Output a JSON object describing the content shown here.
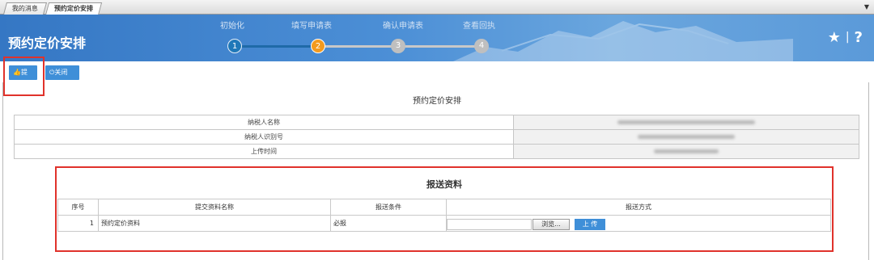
{
  "tabs": [
    {
      "label": "我的消息"
    },
    {
      "label": "预约定价安排"
    }
  ],
  "header": {
    "title": "预约定价安排",
    "steps": [
      {
        "label": "初始化",
        "number": "1",
        "state": "done",
        "color": "#1f78b8"
      },
      {
        "label": "填写申请表",
        "number": "2",
        "state": "current",
        "color": "#f39a1e"
      },
      {
        "label": "确认申请表",
        "number": "3",
        "state": "todo",
        "color": "#bfbfbf"
      },
      {
        "label": "查看回执",
        "number": "4",
        "state": "todo",
        "color": "#bfbfbf"
      }
    ],
    "icons": [
      "star-icon",
      "help-icon"
    ]
  },
  "toolbar": {
    "submit_label": "提交",
    "close_label": "关闭",
    "accent": "#3f8fd8"
  },
  "section_title": "预约定价安排",
  "info_rows": [
    {
      "label": "纳税人名称"
    },
    {
      "label": "纳税人识别号"
    },
    {
      "label": "上传时间"
    }
  ],
  "materials": {
    "title": "报送资料",
    "columns": [
      "序号",
      "提交资料名称",
      "报送条件",
      "报送方式"
    ],
    "rows": [
      {
        "index": "1",
        "name": "预约定价资料",
        "condition": "必报",
        "browse_label": "浏览...",
        "upload_label": "上 传"
      }
    ]
  },
  "highlight_color": "#e0322b"
}
